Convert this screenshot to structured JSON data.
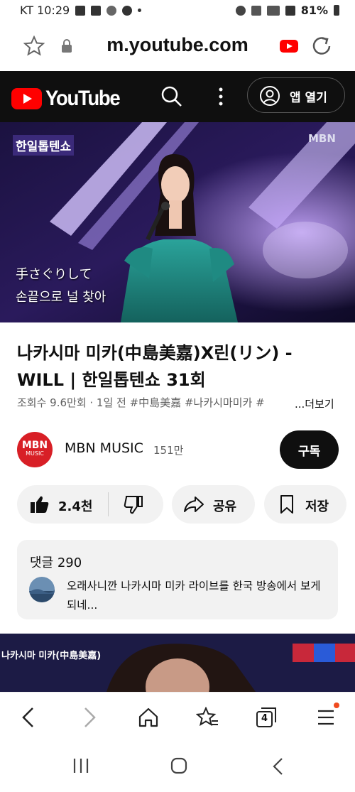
{
  "status_bar": {
    "carrier_time": "KT 10:29",
    "battery": "81%"
  },
  "browser": {
    "url": "m.youtube.com"
  },
  "youtube_header": {
    "logo_text": "YouTube",
    "open_app_label": "앱 열기"
  },
  "video": {
    "badge": "MBN",
    "show_logo": "한일톱텐쇼",
    "caption_line1": "手さぐりして",
    "caption_line2": "손끝으로 널 찾아",
    "title": "나카시마 미카(中島美嘉)X린(リン) - WILL | 한일톱텐쇼 31회",
    "meta": "조회수 9.6만회 · 1일 전  #中島美嘉 #나카시마미카 #",
    "more_label": "...더보기"
  },
  "channel": {
    "name": "MBN MUSIC",
    "subscribers": "151만",
    "logo_line1": "MBN",
    "logo_line2": "MUSIC",
    "subscribe_label": "구독"
  },
  "actions": {
    "like_count": "2.4천",
    "share_label": "공유",
    "save_label": "저장"
  },
  "comments": {
    "title": "댓글 290",
    "first_comment": "오래사니깐 나카시마 미카 라이브를 한국 방송에서 보게되네..."
  },
  "next_video": {
    "caption": "나카시마 미카(中島美嘉)"
  },
  "browser_nav": {
    "tab_count": "4"
  },
  "colors": {
    "youtube_red": "#ff0000",
    "header_bg": "#0f0f0f",
    "pill_bg": "#f2f2f2"
  }
}
